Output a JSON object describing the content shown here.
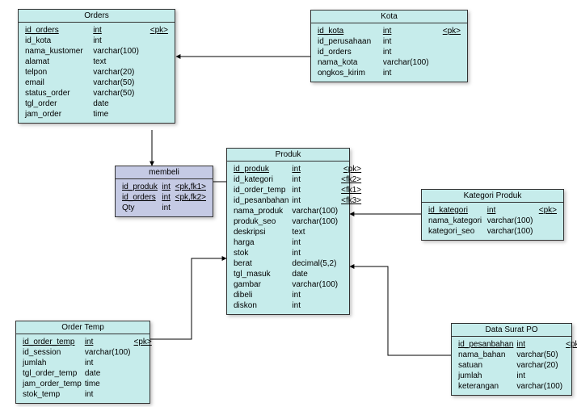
{
  "entities": {
    "orders": {
      "title": "Orders",
      "rows": [
        {
          "name": "id_orders",
          "type": "int",
          "pk": true,
          "key": "<pk>"
        },
        {
          "name": "id_kota",
          "type": "int"
        },
        {
          "name": "nama_kustomer",
          "type": "varchar(100)"
        },
        {
          "name": "alamat",
          "type": "text"
        },
        {
          "name": "telpon",
          "type": "varchar(20)"
        },
        {
          "name": "email",
          "type": "varchar(50)"
        },
        {
          "name": "status_order",
          "type": "varchar(50)"
        },
        {
          "name": "tgl_order",
          "type": "date"
        },
        {
          "name": "jam_order",
          "type": "time"
        }
      ]
    },
    "kota": {
      "title": "Kota",
      "rows": [
        {
          "name": "id_kota",
          "type": "int",
          "pk": true,
          "key": "<pk>"
        },
        {
          "name": "id_perusahaan",
          "type": "int"
        },
        {
          "name": "id_orders",
          "type": "int"
        },
        {
          "name": "nama_kota",
          "type": "varchar(100)"
        },
        {
          "name": "ongkos_kirim",
          "type": "int"
        }
      ]
    },
    "membeli": {
      "title": "membeli",
      "rows": [
        {
          "name": "id_produk",
          "type": "int",
          "pk": true,
          "key": "<pk,fk1>"
        },
        {
          "name": "id_orders",
          "type": "int",
          "pk": true,
          "key": "<pk,fk2>"
        },
        {
          "name": "Qty",
          "type": "int"
        }
      ]
    },
    "produk": {
      "title": "Produk",
      "rows": [
        {
          "name": "id_produk",
          "type": "int",
          "pk": true,
          "key": "<pk>"
        },
        {
          "name": "id_kategori",
          "type": "int",
          "key": "<fk2>"
        },
        {
          "name": "id_order_temp",
          "type": "int",
          "key": "<fk1>"
        },
        {
          "name": "id_pesanbahan",
          "type": "int",
          "key": "<fk3>"
        },
        {
          "name": "nama_produk",
          "type": "varchar(100)"
        },
        {
          "name": "produk_seo",
          "type": "varchar(100)"
        },
        {
          "name": "deskripsi",
          "type": "text"
        },
        {
          "name": "harga",
          "type": "int"
        },
        {
          "name": "stok",
          "type": "int"
        },
        {
          "name": "berat",
          "type": "decimal(5,2)"
        },
        {
          "name": "tgl_masuk",
          "type": "date"
        },
        {
          "name": "gambar",
          "type": "varchar(100)"
        },
        {
          "name": "dibeli",
          "type": "int"
        },
        {
          "name": "diskon",
          "type": "int"
        }
      ]
    },
    "kategori": {
      "title": "Kategori Produk",
      "rows": [
        {
          "name": "id_kategori",
          "type": "int",
          "pk": true,
          "key": "<pk>"
        },
        {
          "name": "nama_kategori",
          "type": "varchar(100)"
        },
        {
          "name": "kategori_seo",
          "type": "varchar(100)"
        }
      ]
    },
    "ordertemp": {
      "title": "Order Temp",
      "rows": [
        {
          "name": "id_order_temp",
          "type": "int",
          "pk": true,
          "key": "<pk>"
        },
        {
          "name": "id_session",
          "type": "varchar(100)"
        },
        {
          "name": "jumlah",
          "type": "int"
        },
        {
          "name": "tgl_order_temp",
          "type": "date"
        },
        {
          "name": "jam_order_temp",
          "type": "time"
        },
        {
          "name": "stok_temp",
          "type": "int"
        }
      ]
    },
    "datasurat": {
      "title": "Data Surat PO",
      "rows": [
        {
          "name": "id_pesanbahan",
          "type": "int",
          "pk": true,
          "key": "<pk>"
        },
        {
          "name": "nama_bahan",
          "type": "varchar(50)"
        },
        {
          "name": "satuan",
          "type": "varchar(20)"
        },
        {
          "name": "jumlah",
          "type": "int"
        },
        {
          "name": "keterangan",
          "type": "varchar(100)"
        }
      ]
    }
  }
}
